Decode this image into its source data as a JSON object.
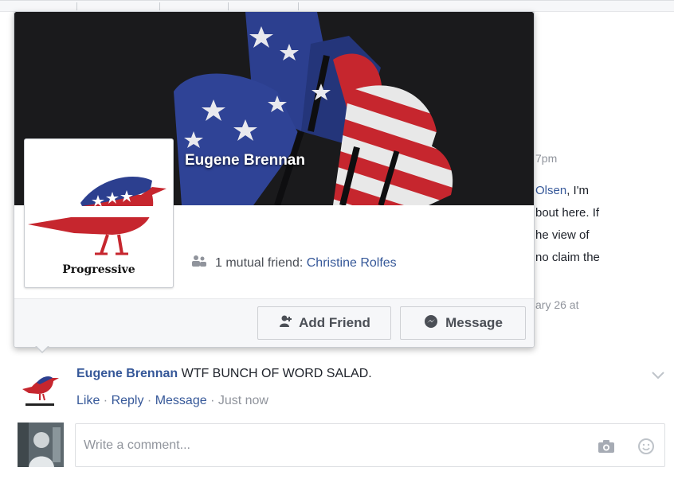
{
  "hovercard": {
    "name": "Eugene Brennan",
    "avatar_caption": "Progressive",
    "mutual_prefix": "1 mutual friend: ",
    "mutual_name": "Christine Rolfes",
    "add_friend_label": "Add Friend",
    "message_label": "Message"
  },
  "background_post": {
    "time_fragment": "7pm",
    "line1_link": "Olsen",
    "line1_rest": ", I'm",
    "line2": "bout here. If",
    "line3": "he view of",
    "line4": "no claim the",
    "date_fragment": "ary 26 at"
  },
  "comment": {
    "author": "Eugene Brennan",
    "text": " WTF BUNCH OF WORD SALAD.",
    "like": "Like",
    "reply": "Reply",
    "message": "Message",
    "time": "Just now",
    "sep": " · "
  },
  "composer": {
    "placeholder": "Write a comment..."
  },
  "icons": [
    "mutual-friends-icon",
    "add-friend-icon",
    "messenger-icon",
    "chevron-down-icon",
    "camera-icon",
    "emoji-icon"
  ],
  "colors": {
    "link": "#365899",
    "cover_bg": "#1a1a1c",
    "flag_blue": "#2c3f8f",
    "flag_red": "#c6262e"
  }
}
